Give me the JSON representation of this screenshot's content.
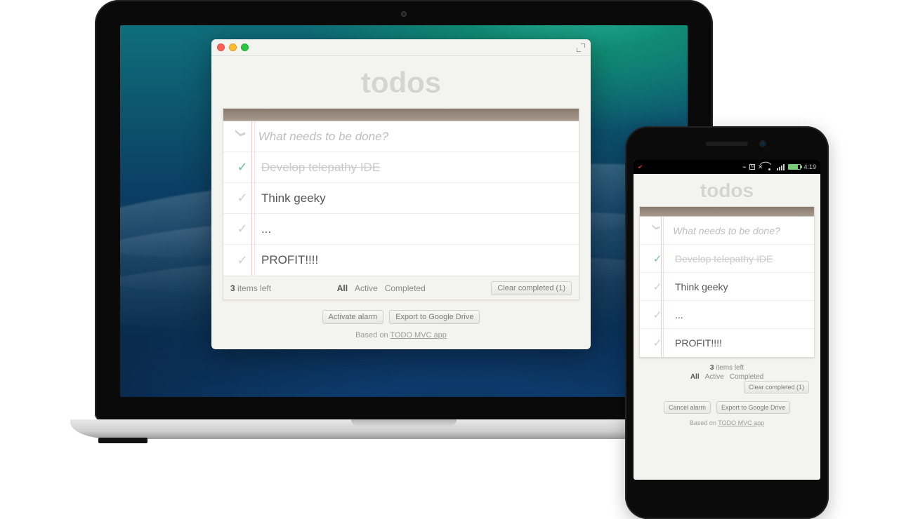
{
  "app": {
    "title": "todos",
    "input_placeholder": "What needs to be done?",
    "items": [
      {
        "text": "Develop telepathy IDE",
        "completed": true
      },
      {
        "text": "Think geeky",
        "completed": false
      },
      {
        "text": "...",
        "completed": false
      },
      {
        "text": "PROFIT!!!!",
        "completed": false
      }
    ],
    "footer": {
      "count": "3",
      "count_label": "items left",
      "filters": {
        "all": "All",
        "active": "Active",
        "completed": "Completed",
        "selected": "all"
      },
      "clear_label": "Clear completed (1)"
    },
    "credit_prefix": "Based on ",
    "credit_link": "TODO MVC app"
  },
  "desktop": {
    "buttons": {
      "alarm": "Activate alarm",
      "export": "Export to Google Drive"
    }
  },
  "mobile": {
    "status": {
      "carrier_icon": "signal",
      "icons": [
        "bluetooth",
        "nfc",
        "no-sim",
        "wifi",
        "signal",
        "battery"
      ],
      "time": "4:19"
    },
    "buttons": {
      "alarm": "Cancel alarm",
      "export": "Export to Google Drive"
    }
  }
}
